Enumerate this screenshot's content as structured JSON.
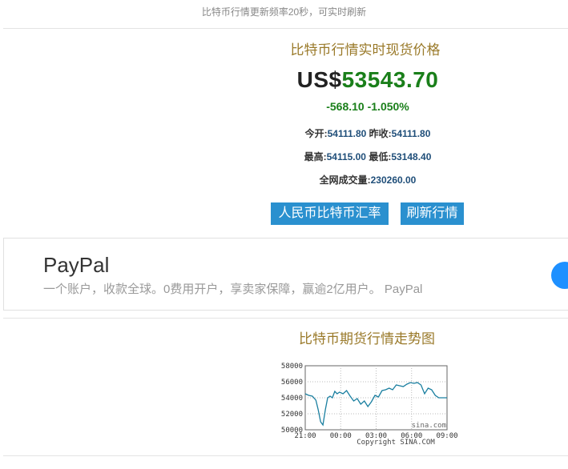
{
  "header": {
    "notice": "比特币行情更新频率20秒，可实时刷新"
  },
  "spot": {
    "title": "比特币行情实时现货价格",
    "currency": "US$",
    "price": "53543.70",
    "change": "-568.10 -1.050%",
    "open_label": "今开:",
    "open_value": "54111.80",
    "prev_close_label": "昨收:",
    "prev_close_value": "54111.80",
    "high_label": "最高:",
    "high_value": "54115.00",
    "low_label": "最低:",
    "low_value": "53148.40",
    "volume_label": "全网成交量:",
    "volume_value": "230260.00",
    "buttons": {
      "rmb_rate": "人民币比特币汇率",
      "refresh": "刷新行情"
    }
  },
  "ad": {
    "title": "PayPal",
    "description": "一个账户，收款全球。0费用开户，享卖家保障，赢逾2亿用户。 PayPal",
    "button_color": "#1e90ff"
  },
  "futures": {
    "title": "比特币期货行情走势图"
  },
  "colors": {
    "accent_gold": "#9a7a2a",
    "price_green": "#1a7f1a",
    "button_blue": "#2a90cf",
    "line_teal": "#1a7fa0"
  },
  "chart_data": {
    "type": "line",
    "title": "",
    "xlabel": "",
    "ylabel": "",
    "x_ticks": [
      "21:00",
      "00:00",
      "03:00",
      "06:00",
      "09:00"
    ],
    "y_ticks": [
      50000,
      52000,
      54000,
      56000,
      58000
    ],
    "xlim": [
      0,
      12
    ],
    "ylim": [
      50000,
      58000
    ],
    "grid": true,
    "watermark": "sina.com",
    "footer": "Copyright  SINA.COM",
    "series": [
      {
        "x": [
          0,
          0.3,
          0.6,
          0.9,
          1.1,
          1.3,
          1.5,
          1.7,
          1.9,
          2.1,
          2.3,
          2.5,
          2.7,
          2.9,
          3.2,
          3.5,
          3.8,
          4.1,
          4.4,
          4.7,
          5.0,
          5.3,
          5.6,
          5.9,
          6.2,
          6.5,
          6.8,
          7.1,
          7.4,
          7.7,
          8.0,
          8.3,
          8.6,
          8.9,
          9.2,
          9.5,
          9.8,
          10.1,
          10.4,
          10.7,
          11.0,
          11.3,
          11.6,
          12.0
        ],
        "y": [
          54500,
          54300,
          54200,
          53700,
          52500,
          51000,
          50600,
          52500,
          54000,
          54200,
          54000,
          54800,
          54500,
          54700,
          54500,
          54900,
          54200,
          53600,
          53900,
          53200,
          53600,
          52900,
          53500,
          54300,
          54100,
          54900,
          55000,
          55200,
          55000,
          55600,
          55500,
          55400,
          55700,
          55900,
          55800,
          55900,
          55600,
          54500,
          55200,
          55000,
          54300,
          54000,
          54000,
          54000
        ]
      }
    ]
  }
}
